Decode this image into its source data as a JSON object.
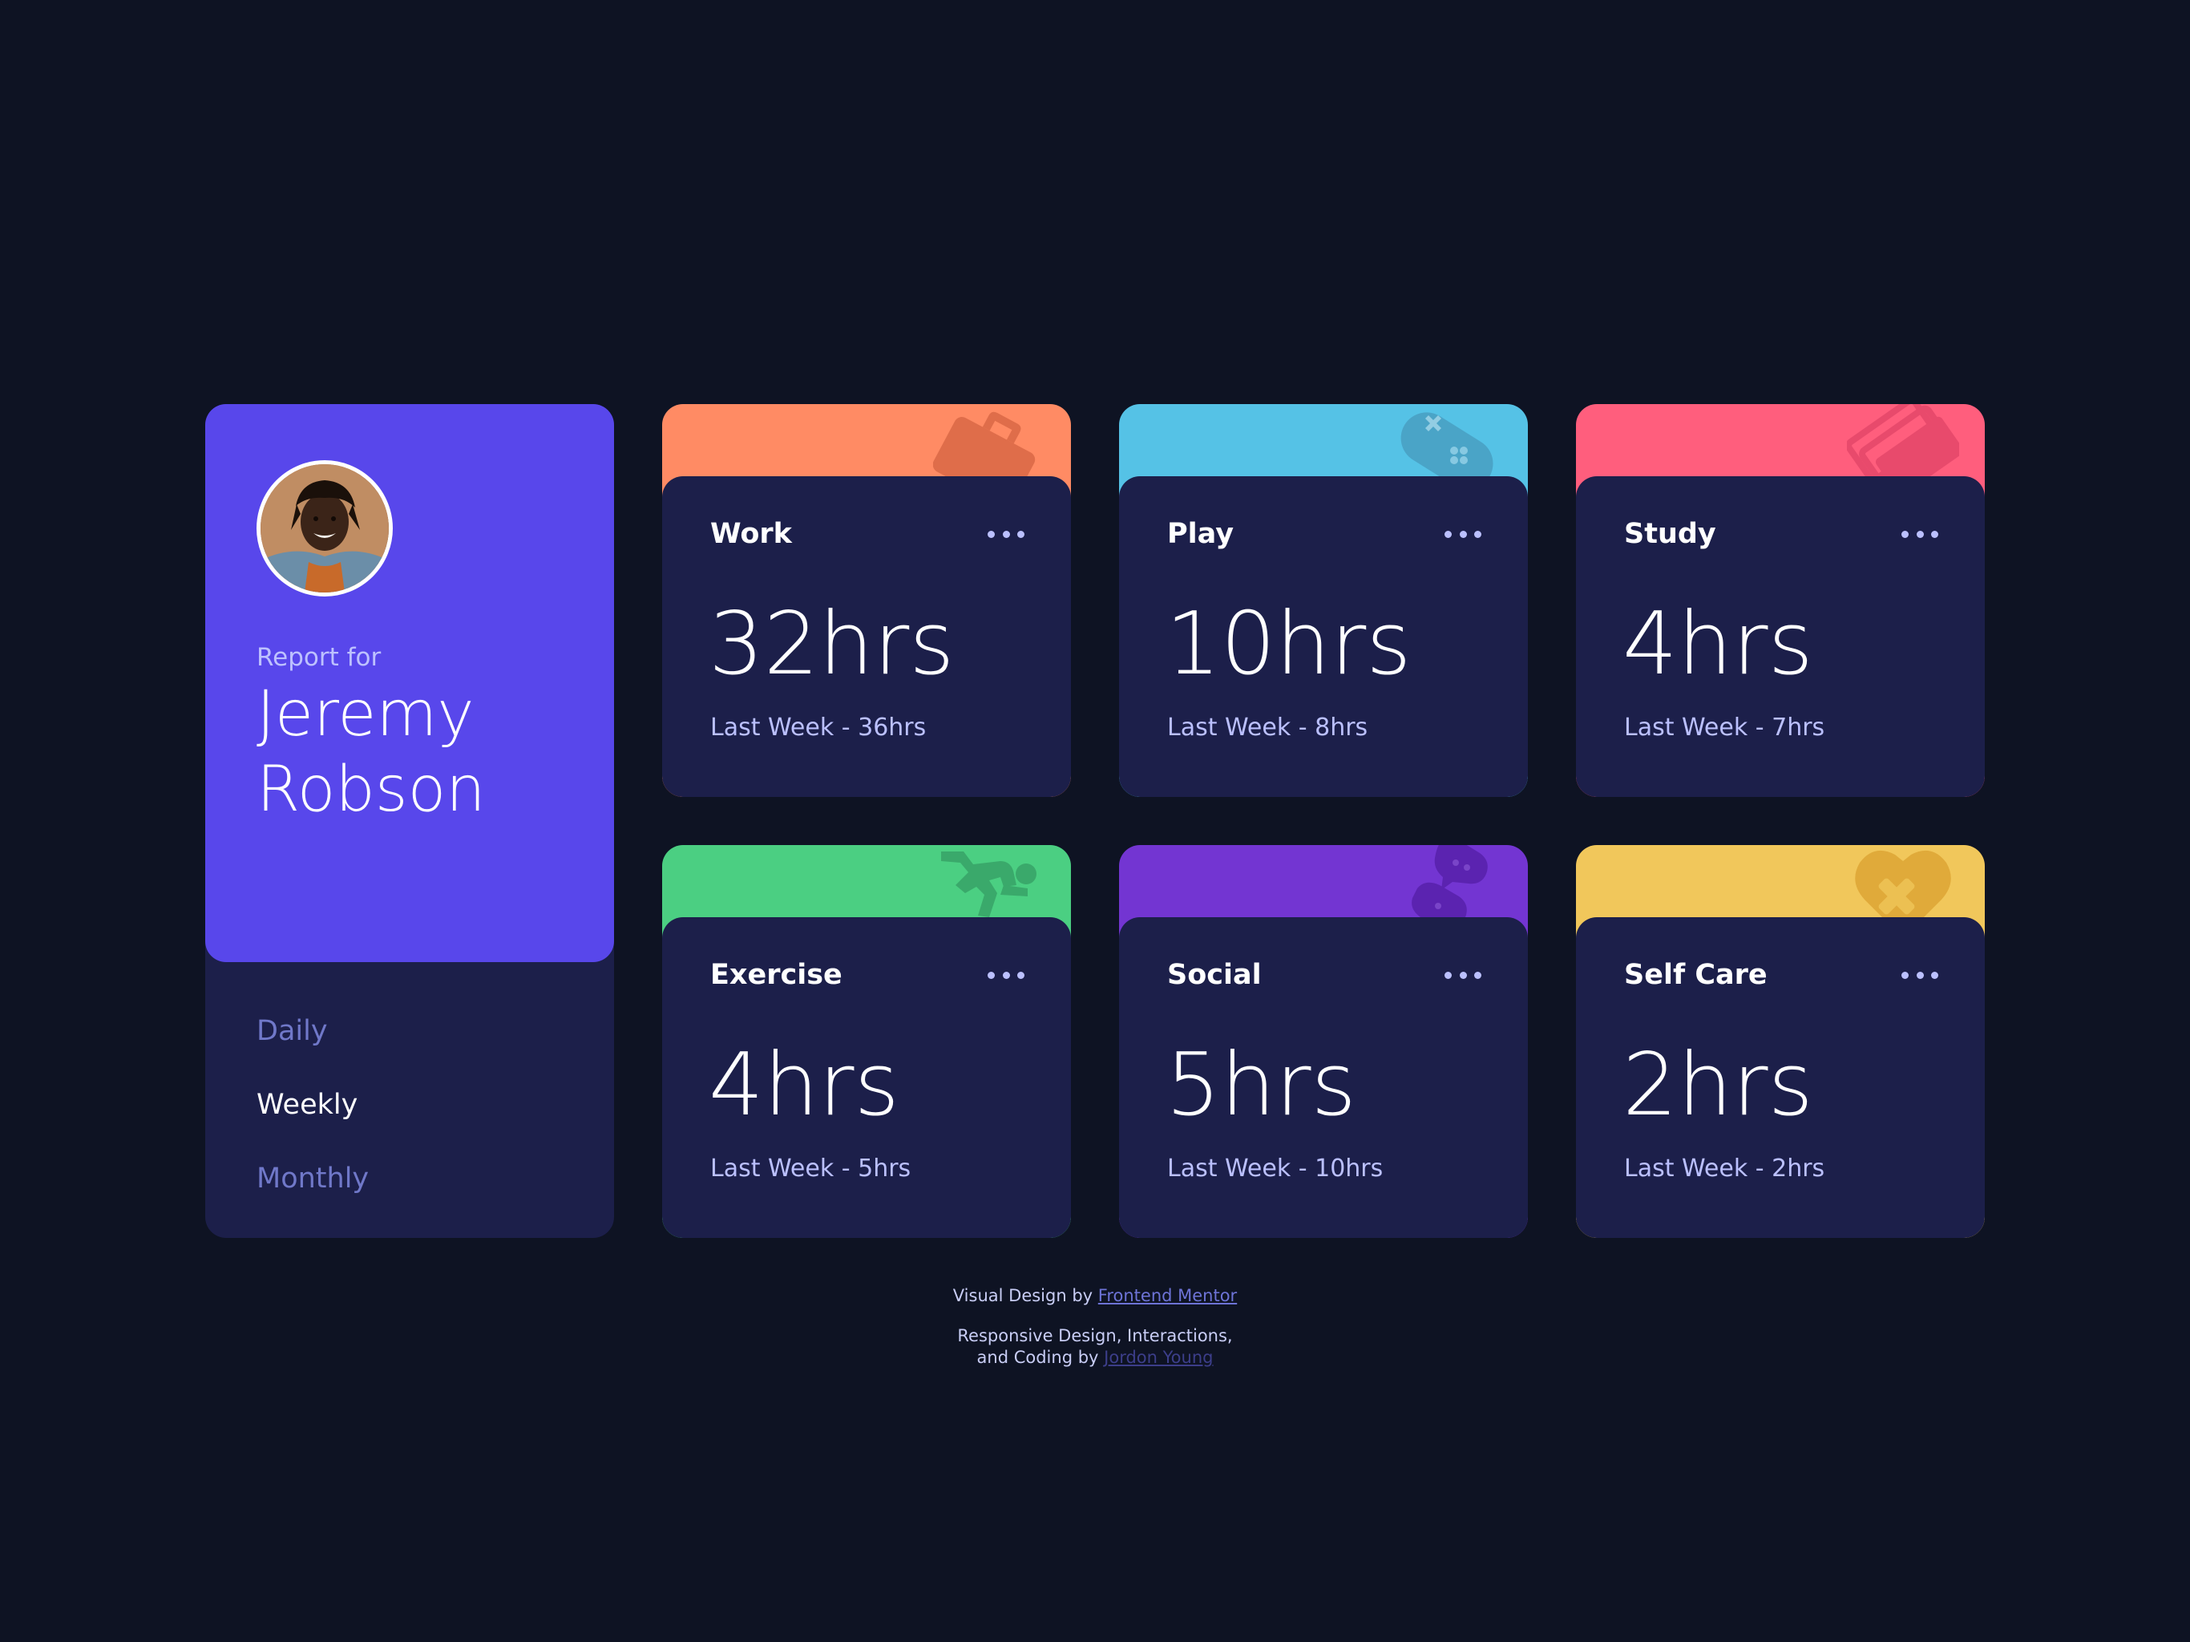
{
  "profile": {
    "report_for": "Report for",
    "name": "Jeremy Robson",
    "avatar_alt": "Jeremy Robson"
  },
  "timeframes": [
    {
      "label": "Daily",
      "active": false
    },
    {
      "label": "Weekly",
      "active": true
    },
    {
      "label": "Monthly",
      "active": false
    }
  ],
  "activities": [
    {
      "title": "Work",
      "current": "32hrs",
      "previous": "Last Week - 36hrs",
      "color": "#ff8b64",
      "icon": "briefcase-icon"
    },
    {
      "title": "Play",
      "current": "10hrs",
      "previous": "Last Week - 8hrs",
      "color": "#55c2e6",
      "icon": "gamepad-icon"
    },
    {
      "title": "Study",
      "current": "4hrs",
      "previous": "Last Week - 7hrs",
      "color": "#ff5e7d",
      "icon": "books-icon"
    },
    {
      "title": "Exercise",
      "current": "4hrs",
      "previous": "Last Week - 5hrs",
      "color": "#4bcf82",
      "icon": "running-icon"
    },
    {
      "title": "Social",
      "current": "5hrs",
      "previous": "Last Week - 10hrs",
      "color": "#7335d2",
      "icon": "chat-icon"
    },
    {
      "title": "Self Care",
      "current": "2hrs",
      "previous": "Last Week - 2hrs",
      "color": "#f1c75b",
      "icon": "heart-bandage-icon"
    }
  ],
  "attribution": {
    "line1_prefix": "Visual Design by",
    "line1_link": "Frontend Mentor",
    "line2_prefix": "Responsive Design, Interactions,",
    "line3_prefix": "and Coding by",
    "line3_link": "Jordon Young"
  },
  "colors": {
    "background": "#0e1323",
    "card": "#1c1f4a",
    "profile": "#5847eb",
    "muted": "#7078c9",
    "pale": "#bbc0ff"
  }
}
